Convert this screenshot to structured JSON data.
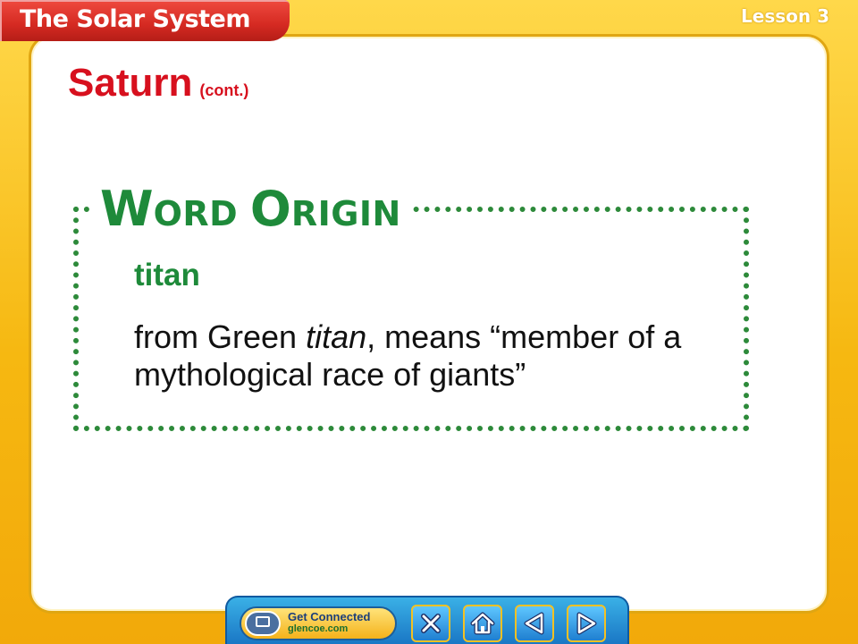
{
  "header": {
    "title": "The Solar System",
    "lesson": "Lesson 3"
  },
  "slide": {
    "heading": "Saturn",
    "heading_sub": "(cont.)",
    "word_origin": {
      "label_first_big": "W",
      "label_first_small": "ORD ",
      "label_second_big": "O",
      "label_second_small": "RIGIN",
      "term": "titan",
      "definition_before": "from Green ",
      "definition_italic": "titan",
      "definition_after": ", means “member of a mythological race of giants”"
    }
  },
  "navbar": {
    "get_connected_label": "Get Connected",
    "get_connected_url": "glencoe.com",
    "buttons": [
      {
        "name": "close",
        "icon": "close-icon"
      },
      {
        "name": "home",
        "icon": "home-icon"
      },
      {
        "name": "previous",
        "icon": "arrow-left-icon"
      },
      {
        "name": "next",
        "icon": "arrow-right-icon"
      }
    ]
  },
  "colors": {
    "frame": "#f7c11c",
    "title_tab": "#d52a22",
    "heading": "#d7101e",
    "accent_green": "#1e8a3a",
    "nav_blue": "#1a77c5"
  }
}
